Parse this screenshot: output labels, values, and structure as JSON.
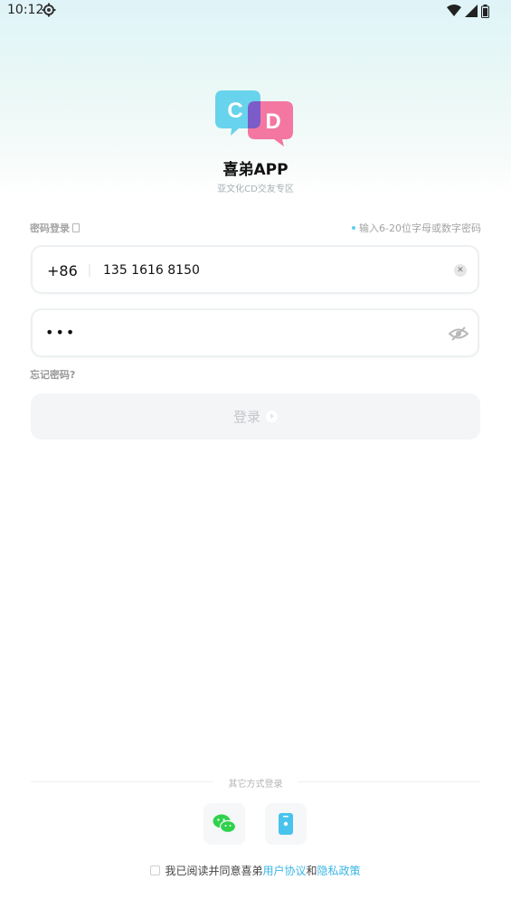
{
  "status_bar": {
    "time": "10:12"
  },
  "app": {
    "title": "喜弟APP",
    "subtitle": "亚文化CD交友专区"
  },
  "login": {
    "mode_label": "密码登录",
    "hint": "输入6-20位字母或数字密码",
    "country_code": "+86",
    "phone_value": "135 1616 8150",
    "password_mask": "•••",
    "forgot_label": "忘记密码?",
    "submit_label": "登录"
  },
  "other_login": {
    "label": "其它方式登录"
  },
  "agreement": {
    "prefix": "我已阅读并同意喜弟",
    "user_agreement": "用户协议",
    "connector": "和",
    "privacy_policy": "隐私政策"
  },
  "colors": {
    "accent": "#3ab6e6",
    "logo_blue": "#68d3ec",
    "logo_pink": "#f377a0",
    "wechat_green": "#2fd24d"
  },
  "icons": [
    "settings-gear-icon",
    "wifi-icon",
    "signal-icon",
    "battery-icon",
    "clear-icon",
    "eye-hidden-icon",
    "chevron-right-icon",
    "wechat-icon",
    "mobile-phone-icon"
  ]
}
